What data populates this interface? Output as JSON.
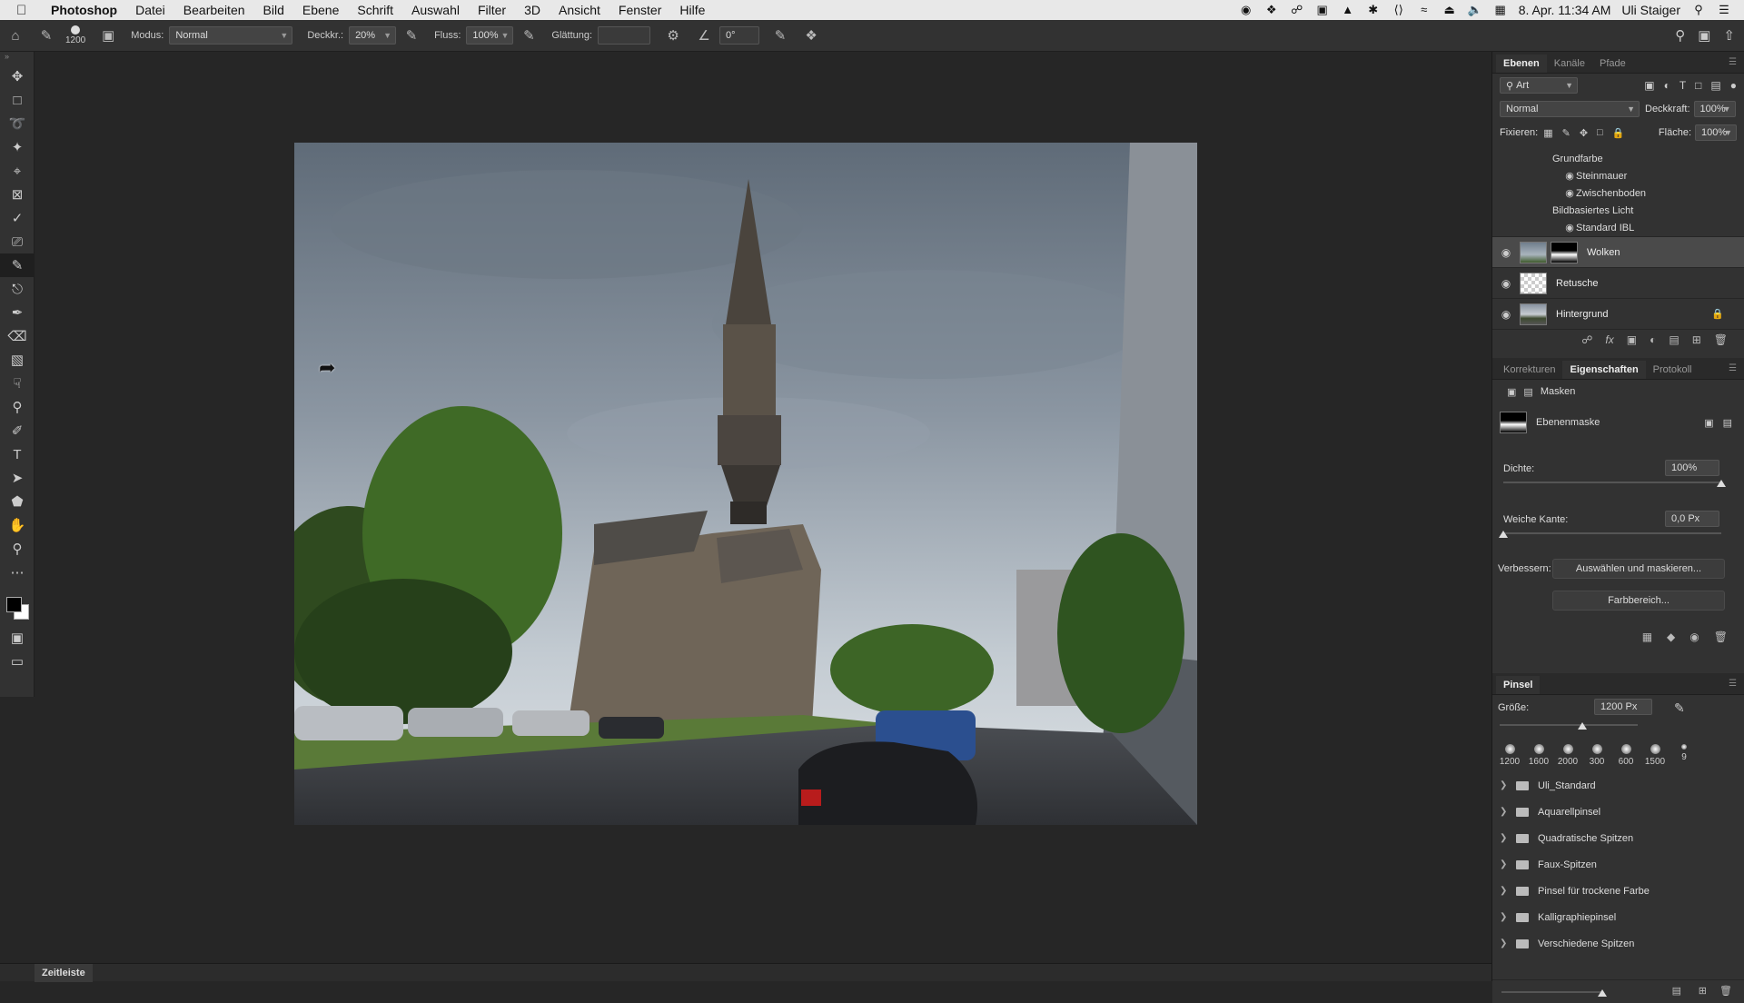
{
  "menubar": {
    "app_name": "Photoshop",
    "items": [
      "Datei",
      "Bearbeiten",
      "Bild",
      "Ebene",
      "Schrift",
      "Auswahl",
      "Filter",
      "3D",
      "Ansicht",
      "Fenster",
      "Hilfe"
    ],
    "datetime": "8. Apr. 11:34 AM",
    "user": "Uli Staiger"
  },
  "options": {
    "brush_size": "1200",
    "mode_label": "Modus:",
    "mode_value": "Normal",
    "opacity_label": "Deckkr.:",
    "opacity_value": "20%",
    "flow_label": "Fluss:",
    "flow_value": "100%",
    "smoothing_label": "Glättung:",
    "smoothing_value": "",
    "angle_value": "0°"
  },
  "layers_panel": {
    "tabs": [
      "Ebenen",
      "Kanäle",
      "Pfade"
    ],
    "filter_kind": "Art",
    "blend_mode": "Normal",
    "opacity_label": "Deckkraft:",
    "opacity_value": "100%",
    "lock_label": "Fixieren:",
    "fill_label": "Fläche:",
    "fill_value": "100%",
    "effects": {
      "base_color": "Grundfarbe",
      "stone_wall": "Steinmauer",
      "intermediate_floor": "Zwischenboden",
      "ibl": "Bildbasiertes Licht",
      "standard_ibl": "Standard IBL"
    },
    "layers": [
      {
        "name": "Wolken",
        "selected": true
      },
      {
        "name": "Retusche",
        "selected": false
      },
      {
        "name": "Hintergrund",
        "selected": false
      }
    ]
  },
  "properties_panel": {
    "tabs": [
      "Korrekturen",
      "Eigenschaften",
      "Protokoll"
    ],
    "masks_label": "Masken",
    "layer_mask_label": "Ebenenmaske",
    "density_label": "Dichte:",
    "density_value": "100%",
    "density_fraction": 1.0,
    "feather_label": "Weiche Kante:",
    "feather_value": "0,0 Px",
    "feather_fraction": 0.0,
    "refine_label": "Verbessern:",
    "select_and_mask_button": "Auswählen und maskieren...",
    "color_range_button": "Farbbereich..."
  },
  "brush_panel": {
    "title": "Pinsel",
    "size_label": "Größe:",
    "size_value": "1200 Px",
    "size_fraction": 0.6,
    "tips": [
      "1200",
      "1600",
      "2000",
      "300",
      "600",
      "1500",
      "9"
    ],
    "folders": [
      "Uli_Standard",
      "Aquarellpinsel",
      "Quadratische Spitzen",
      "Faux-Spitzen",
      "Pinsel für trockene Farbe",
      "Kalligraphiepinsel",
      "Verschiedene Spitzen"
    ]
  },
  "bottom": {
    "timeline_label": "Zeitleiste"
  }
}
